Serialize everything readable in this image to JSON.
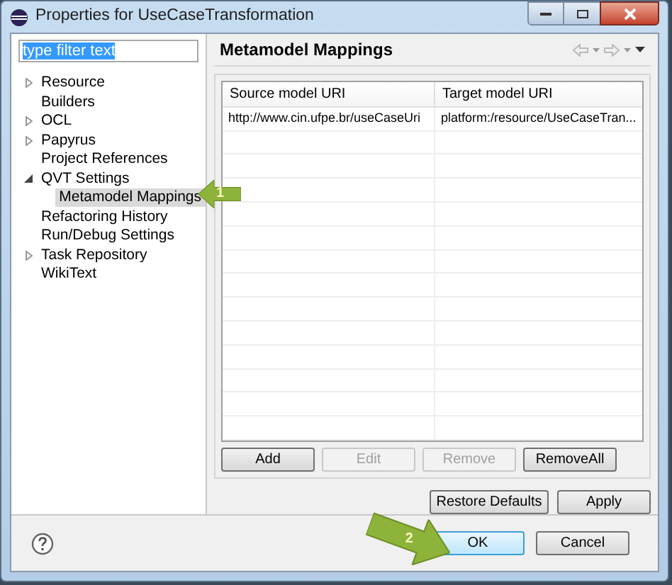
{
  "window": {
    "title": "Properties for UseCaseTransformation"
  },
  "filter": {
    "value": "type filter text"
  },
  "tree": [
    {
      "label": "Resource",
      "expanded": false
    },
    {
      "label": "Builders"
    },
    {
      "label": "OCL",
      "expanded": false
    },
    {
      "label": "Papyrus",
      "expanded": false
    },
    {
      "label": "Project References"
    },
    {
      "label": "QVT Settings",
      "expanded": true,
      "children": [
        {
          "label": "Metamodel Mappings",
          "selected": true
        }
      ]
    },
    {
      "label": "Refactoring History"
    },
    {
      "label": "Run/Debug Settings"
    },
    {
      "label": "Task Repository",
      "expanded": false
    },
    {
      "label": "WikiText"
    }
  ],
  "page": {
    "title": "Metamodel Mappings"
  },
  "table": {
    "columns": [
      "Source model URI",
      "Target model URI"
    ],
    "rows": [
      [
        "http://www.cin.ufpe.br/useCaseUri",
        "platform:/resource/UseCaseTran..."
      ]
    ]
  },
  "table_buttons": [
    {
      "label": "Add",
      "disabled": false
    },
    {
      "label": "Edit",
      "disabled": true
    },
    {
      "label": "Remove",
      "disabled": true
    },
    {
      "label": "RemoveAll",
      "disabled": false
    }
  ],
  "page_buttons": [
    {
      "label": "Restore Defaults"
    },
    {
      "label": "Apply"
    }
  ],
  "dialog_buttons": [
    {
      "label": "OK",
      "default": true
    },
    {
      "label": "Cancel",
      "default": false
    }
  ],
  "callouts": [
    {
      "label": "1"
    },
    {
      "label": "2"
    }
  ]
}
